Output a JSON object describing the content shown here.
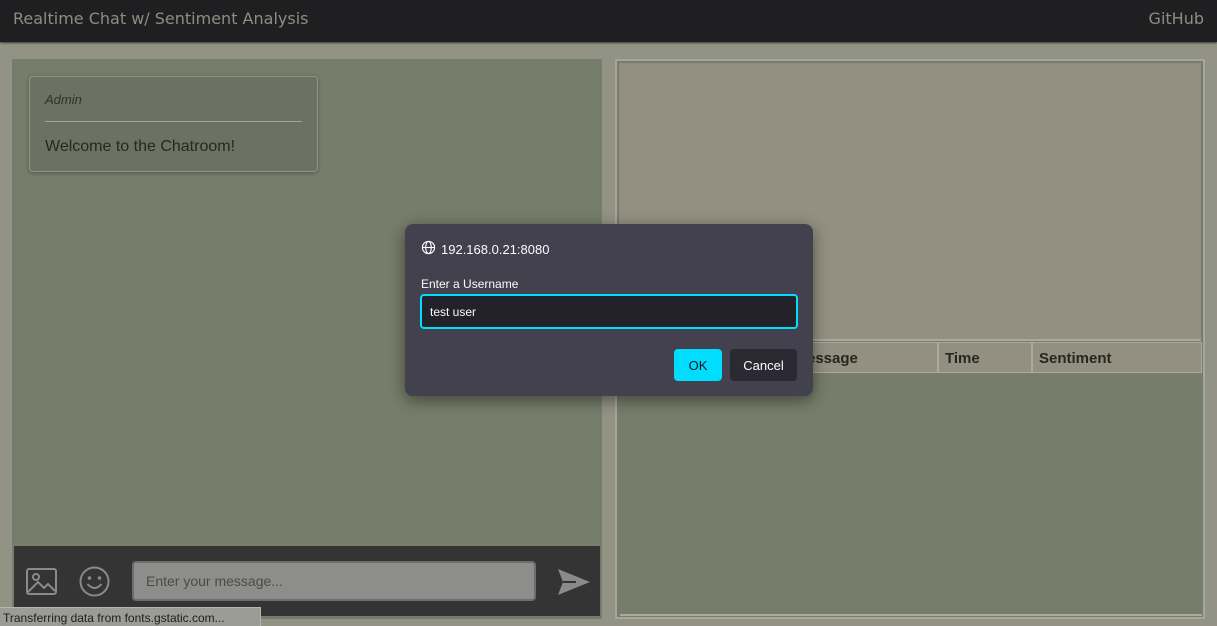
{
  "header": {
    "title": "Realtime Chat w/ Sentiment Analysis",
    "github_link": "GitHub"
  },
  "chat": {
    "messages": [
      {
        "author": "Admin",
        "text": "Welcome to the Chatroom!"
      }
    ],
    "input_placeholder": "Enter your message..."
  },
  "table": {
    "headers": [
      "Message",
      "Time",
      "Sentiment"
    ],
    "header_visible_text": [
      "essage",
      "Time",
      "Sentiment"
    ]
  },
  "status_bar": {
    "text": "Transferring data from fonts.gstatic.com..."
  },
  "dialog": {
    "origin": "192.168.0.21:8080",
    "prompt": "Enter a Username",
    "input_value": "test user",
    "ok_label": "OK",
    "cancel_label": "Cancel"
  },
  "colors": {
    "accent": "#00ddff",
    "dialog_bg": "#42414d",
    "navbar_bg": "#1f1f21",
    "chat_bg": "#767d6a"
  }
}
